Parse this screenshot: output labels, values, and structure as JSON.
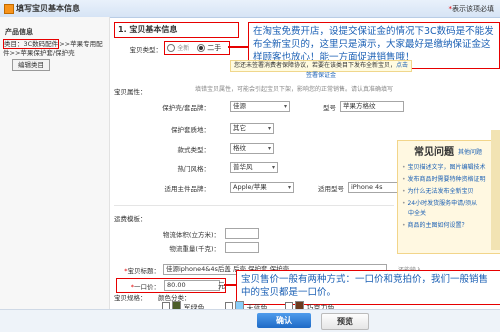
{
  "header": {
    "title": "填写宝贝基本信息",
    "required_note": "表示该项必填"
  },
  "sidebar": {
    "heading": "产品信息",
    "category_line1": "类目：3C数码配件",
    "category_line2": "件>>苹果保护套/保护壳",
    "category_suffix": ">>苹果专用配",
    "edit_button": "编辑类目"
  },
  "section": {
    "title": "1. 宝贝基本信息"
  },
  "form": {
    "type_label": "宝贝类型：",
    "type_new": "全新",
    "type_used": "二手",
    "notice_text": "您还未签署消费者保障协议，若要在该类目下发布全新宝贝，",
    "notice_link": "点击签署保证金",
    "attr_label": "宝贝属性：",
    "attr_hint": "填错宝贝属性，可能会引起宝贝下架，影响您的正常销售。请认真准确填写",
    "brand_label": "保护壳/套品牌：",
    "brand_value": "佳源",
    "model_label": "型号",
    "model_value": "苹果方格纹",
    "material_label": "保护套质地：",
    "material_value": "其它",
    "style_label": "款式类型：",
    "style_value": "格纹",
    "hot_label": "热门风格：",
    "hot_value": "普华风",
    "fit_label": "适用主件品牌：",
    "fit_value": "Apple/苹果",
    "fit_model_label": "适用型号",
    "fit_model_value": "iPhone 4s",
    "shipping_label": "运费模板：",
    "volume_label": "物流体积(立方米)：",
    "weight_label": "物流重量(千克)：",
    "title_label": "宝贝标题：",
    "title_value": "佳源iphone4&4s后盖 后壳 保护套 保护壳",
    "title_count": "还能输入",
    "price_label": "一口价：",
    "price_value": "80.00",
    "price_unit": "元",
    "spec_label": "宝贝规格：",
    "color_label": "颜色分类：",
    "colors": [
      "军绿色",
      "天蓝色",
      "巧克力色"
    ]
  },
  "callouts": {
    "top": "在淘宝免费开店，设提交保证金的情况下3C数码是不能发布全新宝贝的，这里只是演示，大家最好是缴纳保证金这样顾客也放心！能一方面促进销售哦！",
    "bottom": "宝贝售价一般有两种方式：一口价和竞拍价，我们一般销售中的宝贝都是一口价。"
  },
  "faq": {
    "title": "常见问题",
    "subtitle": "其他问题",
    "items": [
      "宝贝描述文字，图片编辑技术",
      "发布商品时需要特种资格证明",
      "为什么无法发布全新宝贝",
      "24小时发货服务申请/须从",
      "中全关",
      "商品的主图如何设置？"
    ]
  },
  "footer": {
    "confirm": "确认",
    "preview": "预览"
  },
  "colors": {
    "accent": "#1e6ac6",
    "highlight": "#e60000",
    "callout_text": "#1a5fb4"
  }
}
